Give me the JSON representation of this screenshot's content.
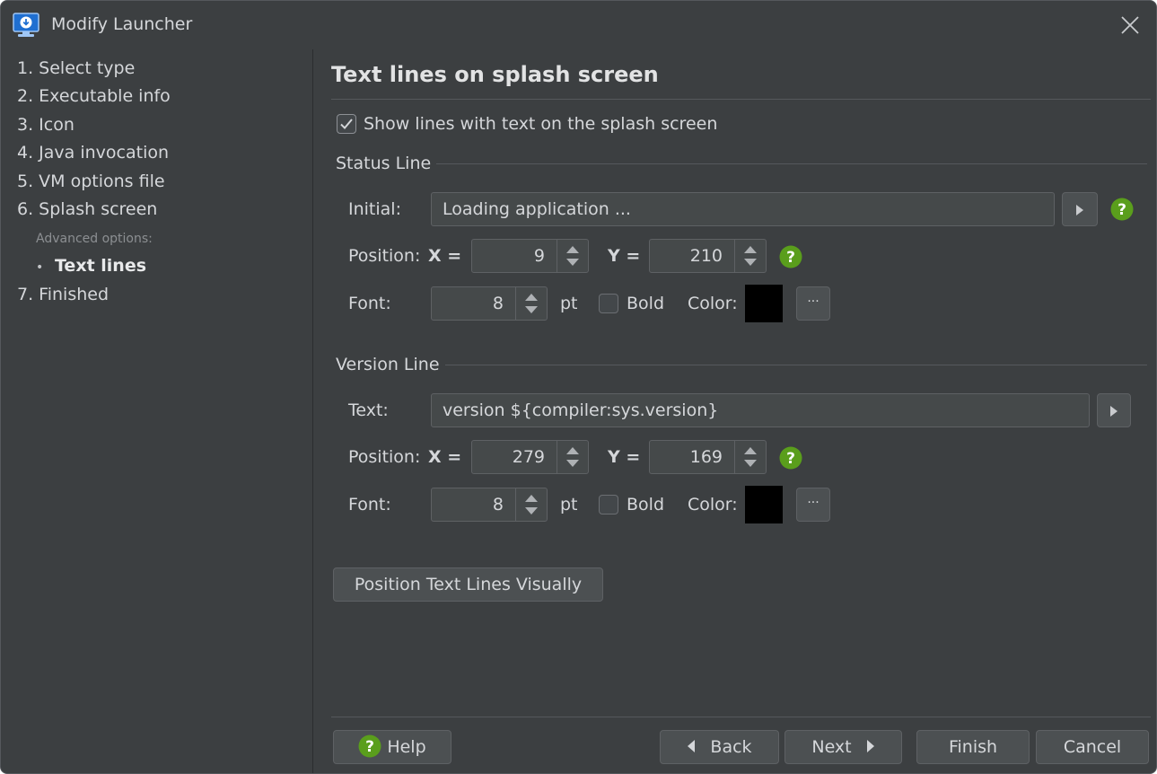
{
  "window": {
    "title": "Modify Launcher",
    "icon": "monitor-download-icon",
    "close_icon": "close-icon"
  },
  "sidebar": {
    "steps": [
      {
        "label": "1. Select type"
      },
      {
        "label": "2. Executable info"
      },
      {
        "label": "3. Icon"
      },
      {
        "label": "4. Java invocation"
      },
      {
        "label": "5. VM options file"
      },
      {
        "label": "6. Splash screen"
      }
    ],
    "advanced_label": "Advanced options:",
    "current_bullet": "•",
    "current_item": "Text lines",
    "final_step": "7. Finished"
  },
  "main": {
    "title": "Text lines on splash screen",
    "show_lines": {
      "label": "Show lines with text on the splash screen",
      "checked": true
    },
    "status_line": {
      "section_title": "Status Line",
      "initial_label": "Initial:",
      "initial_value": "Loading application ...",
      "position_label": "Position:",
      "x_label": "X =",
      "x_value": "9",
      "y_label": "Y =",
      "y_value": "210",
      "font_label": "Font:",
      "font_size": "8",
      "pt_label": "pt",
      "bold_label": "Bold",
      "bold_checked": false,
      "color_label": "Color:",
      "color_value": "#000000",
      "ellipsis": "···"
    },
    "version_line": {
      "section_title": "Version Line",
      "text_label": "Text:",
      "text_value": "version ${compiler:sys.version}",
      "position_label": "Position:",
      "x_label": "X =",
      "x_value": "279",
      "y_label": "Y =",
      "y_value": "169",
      "font_label": "Font:",
      "font_size": "8",
      "pt_label": "pt",
      "bold_label": "Bold",
      "bold_checked": false,
      "color_label": "Color:",
      "color_value": "#000000",
      "ellipsis": "···"
    },
    "position_visual_button": "Position Text Lines Visually"
  },
  "footer": {
    "help": "Help",
    "back": "Back",
    "next": "Next",
    "finish": "Finish",
    "cancel": "Cancel"
  },
  "colors": {
    "background": "#3c3f41",
    "help_green": "#5a9e1c",
    "text": "#d5d7da"
  }
}
